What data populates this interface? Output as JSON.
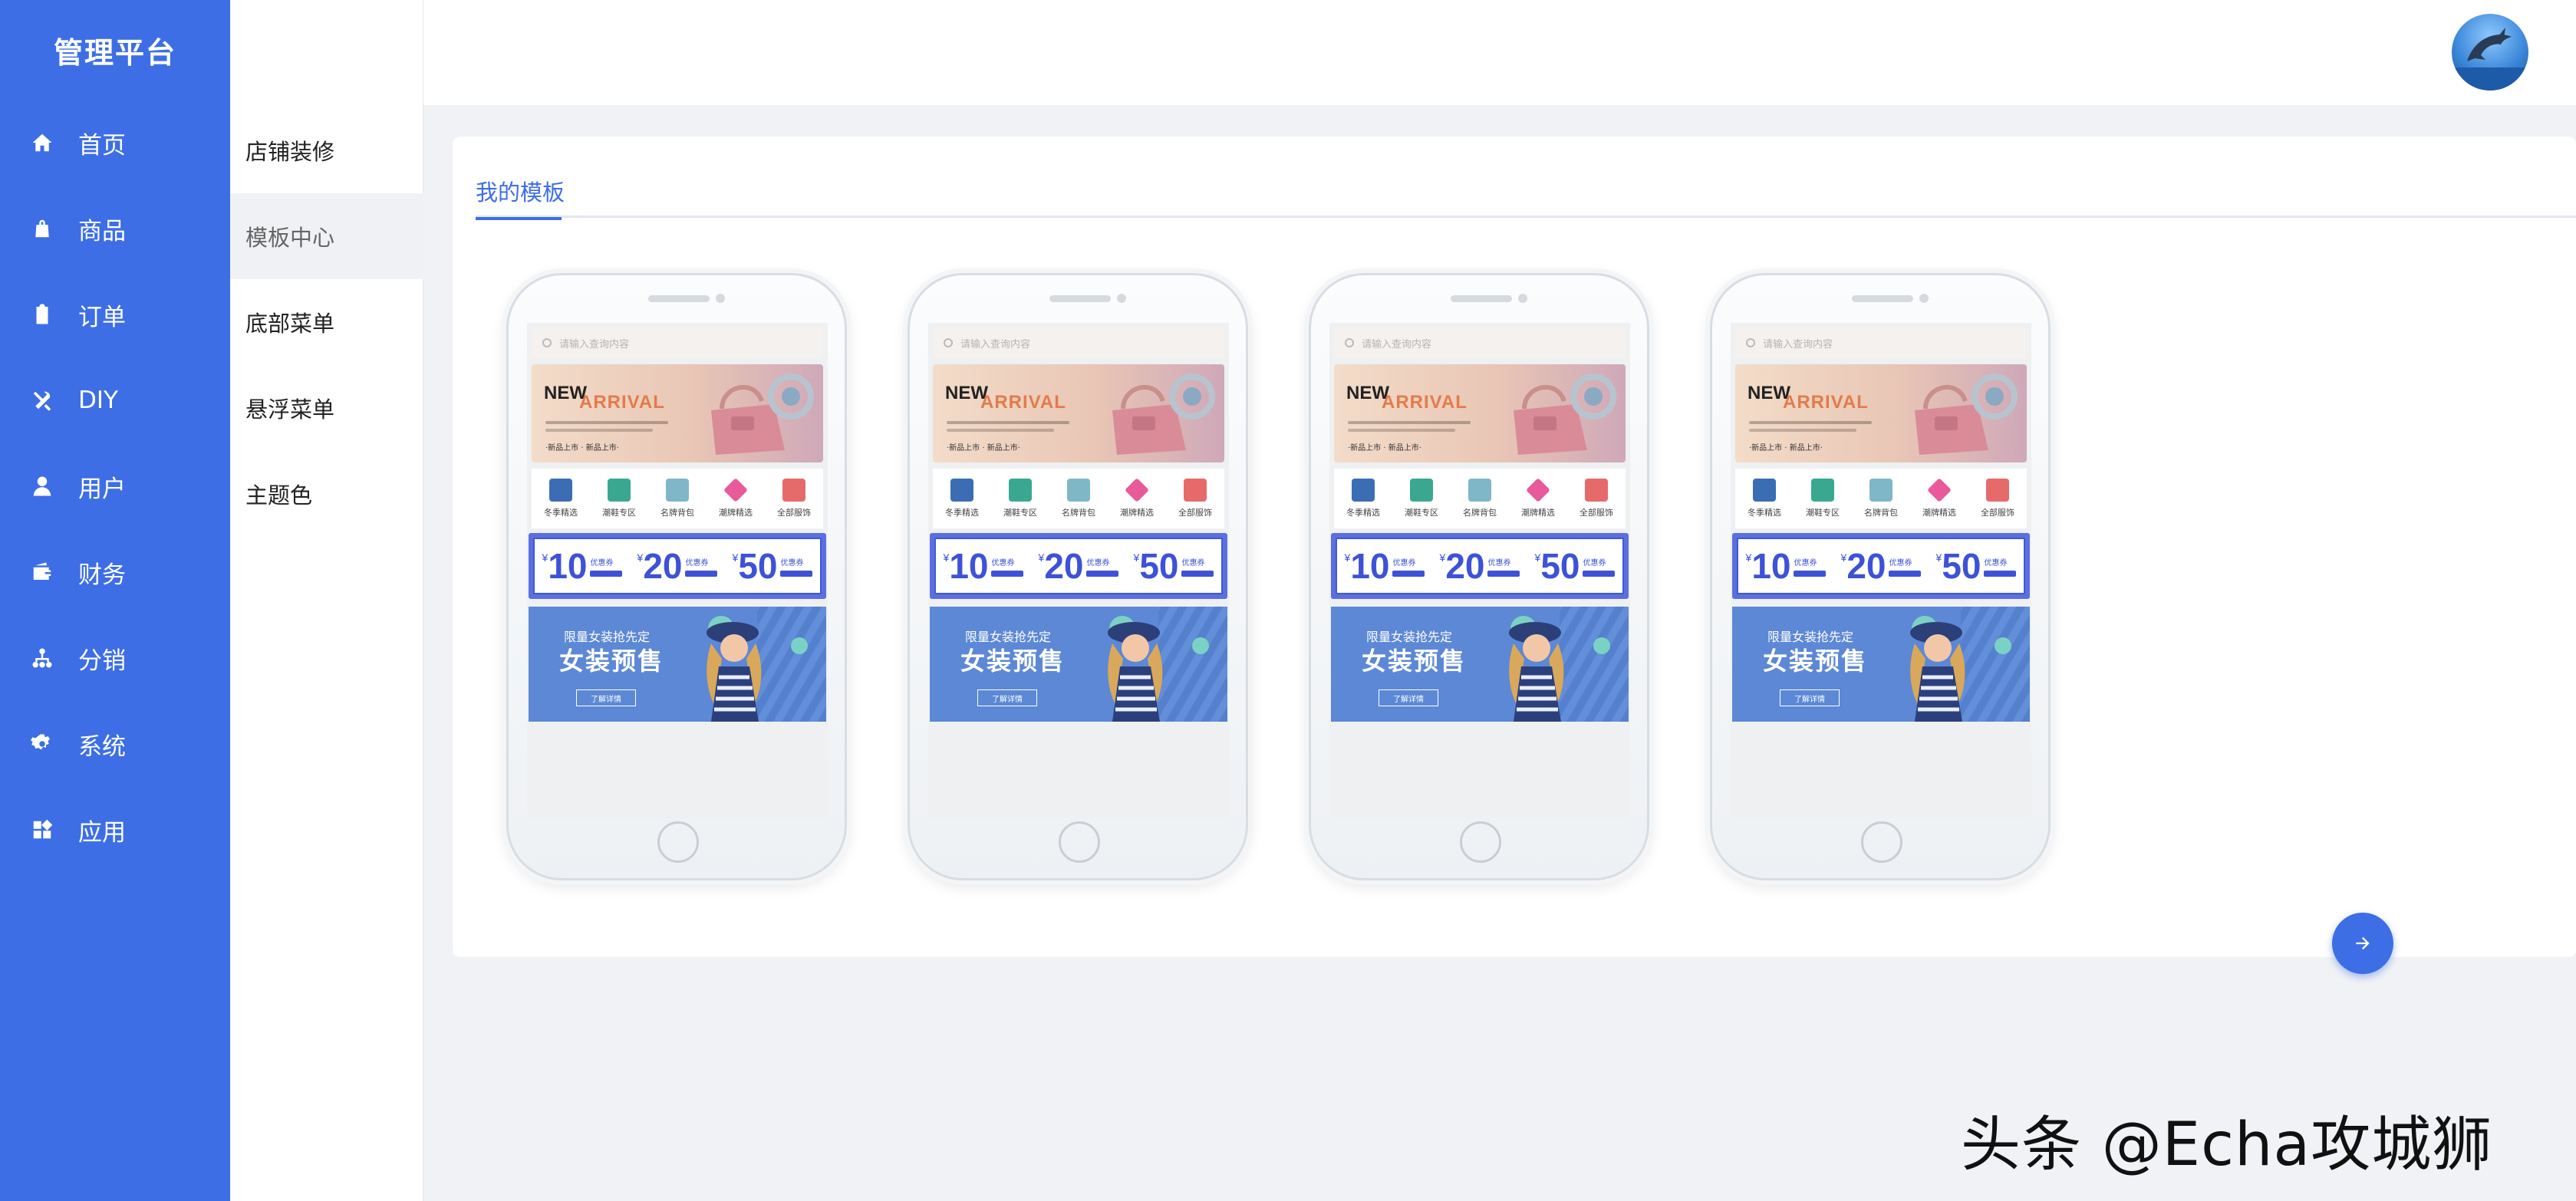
{
  "app": {
    "title": "管理平台"
  },
  "nav": {
    "items": [
      {
        "label": "首页",
        "icon": "home-icon"
      },
      {
        "label": "商品",
        "icon": "bag-icon"
      },
      {
        "label": "订单",
        "icon": "clipboard-icon"
      },
      {
        "label": "DIY",
        "icon": "tools-icon"
      },
      {
        "label": "用户",
        "icon": "user-icon"
      },
      {
        "label": "财务",
        "icon": "wallet-icon"
      },
      {
        "label": "分销",
        "icon": "sitemap-icon"
      },
      {
        "label": "系统",
        "icon": "gear-icon"
      },
      {
        "label": "应用",
        "icon": "apps-icon"
      }
    ]
  },
  "submenu": {
    "items": [
      {
        "label": "店铺装修"
      },
      {
        "label": "模板中心",
        "active": true
      },
      {
        "label": "底部菜单"
      },
      {
        "label": "悬浮菜单"
      },
      {
        "label": "主题色"
      }
    ]
  },
  "header": {
    "avatar": "dolphin-avatar"
  },
  "tabs": {
    "active_label": "我的模板"
  },
  "template": {
    "search_placeholder": "请输入查询内容",
    "banner_new": "NEW",
    "banner_arrival": "ARRIVAL",
    "banner_sub": "·新品上市 · 新品上市·",
    "categories": [
      "冬季精选",
      "潮鞋专区",
      "名牌背包",
      "潮牌精选",
      "全部服饰"
    ],
    "coupons": [
      {
        "amount": "10",
        "label": "优惠券"
      },
      {
        "amount": "20",
        "label": "优惠券"
      },
      {
        "amount": "50",
        "label": "优惠券"
      }
    ],
    "promo_line1": "限量女装抢先定",
    "promo_line2": "女装预售",
    "promo_btn": "了解详情"
  },
  "watermark": "头条 @Echa攻城狮",
  "colors": {
    "primary": "#3d6ee6",
    "background": "#f0f2f5"
  }
}
